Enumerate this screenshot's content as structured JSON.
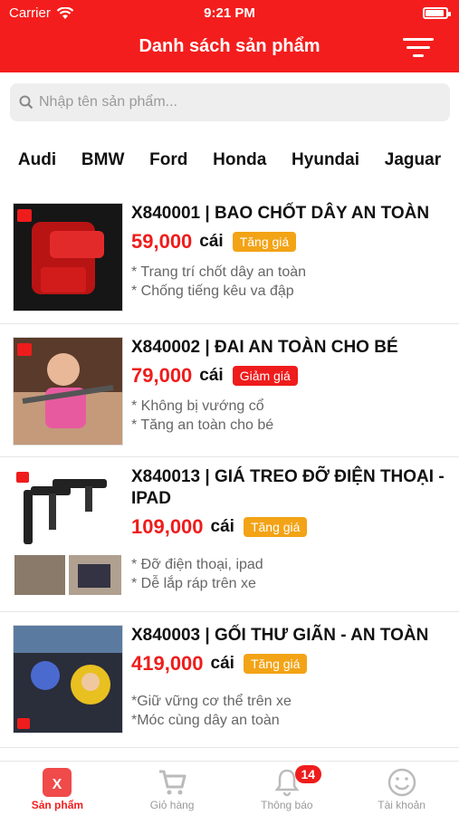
{
  "status_bar": {
    "carrier": "Carrier",
    "time": "9:21 PM"
  },
  "header": {
    "title": "Danh sách sản phẩm"
  },
  "search": {
    "placeholder": "Nhập tên sản phẩm..."
  },
  "brands": [
    "Audi",
    "BMW",
    "Ford",
    "Honda",
    "Hyundai",
    "Jaguar"
  ],
  "products": [
    {
      "name": "X840001 | BAO CHỐT DÂY AN TOÀN",
      "price": "59,000",
      "unit": "cái",
      "badge": "Tăng giá",
      "badge_color": "#f3a316",
      "desc": [
        "* Trang trí chốt dây an toàn",
        "* Chống tiếng kêu va đập"
      ]
    },
    {
      "name": "X840002 | ĐAI AN TOÀN CHO BÉ",
      "price": "79,000",
      "unit": "cái",
      "badge": "Giảm giá",
      "badge_color": "#ef1c1c",
      "desc": [
        "* Không bị vướng cổ",
        "* Tăng an toàn cho bé"
      ]
    },
    {
      "name": "X840013 | GIÁ TREO ĐỠ ĐIỆN THOẠI - IPAD",
      "price": "109,000",
      "unit": "cái",
      "badge": "Tăng giá",
      "badge_color": "#f3a316",
      "desc": [
        "* Đỡ điện thoại, ipad",
        "* Dễ lắp ráp trên xe"
      ]
    },
    {
      "name": "X840003 | GỐI THƯ GIÃN - AN TOÀN",
      "price": "419,000",
      "unit": "cái",
      "badge": "Tăng giá",
      "badge_color": "#f3a316",
      "desc": [
        "*Giữ vững cơ thể trên xe",
        "*Móc cùng dây an toàn"
      ]
    }
  ],
  "tabs": [
    {
      "label": "Sản phẩm",
      "icon": "products-icon",
      "active": true
    },
    {
      "label": "Giỏ hàng",
      "icon": "cart-icon",
      "active": false
    },
    {
      "label": "Thông báo",
      "icon": "bell-icon",
      "active": false,
      "count": "14"
    },
    {
      "label": "Tài khoản",
      "icon": "account-icon",
      "active": false
    }
  ],
  "colors": {
    "primary": "#f41d1d",
    "price": "#ef1c1c",
    "badge_up": "#f3a316",
    "badge_down": "#ef1c1c"
  }
}
